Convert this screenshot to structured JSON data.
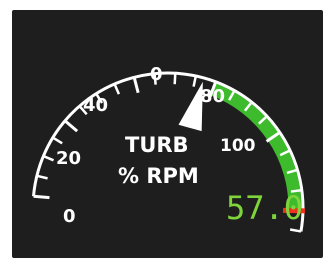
{
  "gauge": {
    "title_line1": "TURB",
    "title_line2": "% RPM",
    "readout": "57.0",
    "scale_labels": [
      "0",
      "20",
      "40",
      "0",
      "80",
      "100"
    ],
    "pointer_value_percent": 57.0,
    "scale_min": 0,
    "scale_max": 105,
    "green_range": [
      60,
      100
    ],
    "red_line": 100,
    "colors": {
      "background": "#1e1e1e",
      "scale": "#ffffff",
      "green_arc": "#3dbb2c",
      "red_line": "#f0321e",
      "readout": "#7fd43c"
    }
  }
}
